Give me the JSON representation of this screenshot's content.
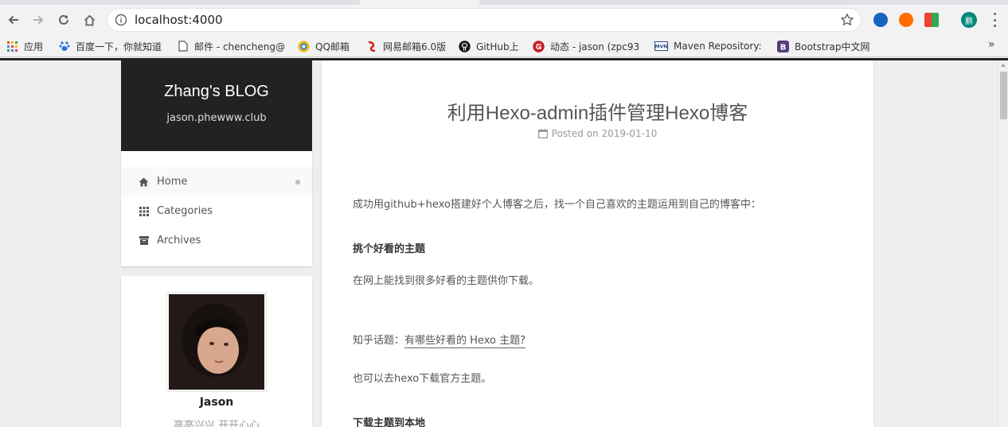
{
  "browser": {
    "url": "localhost:4000",
    "profile_initial": "鹏",
    "bookmarks": [
      {
        "label": "应用",
        "icon": "apps-grid-icon"
      },
      {
        "label": "百度一下，你就知道",
        "icon": "baidu-paw-icon"
      },
      {
        "label": "邮件 - chencheng@",
        "icon": "document-icon"
      },
      {
        "label": "QQ邮箱",
        "icon": "qq-mail-icon"
      },
      {
        "label": "网易邮箱6.0版",
        "icon": "netease-mail-icon"
      },
      {
        "label": "GitHub上",
        "icon": "github-icon"
      },
      {
        "label": "动态 - jason (zpc93",
        "icon": "gitee-icon"
      },
      {
        "label": "Maven Repository:",
        "icon": "maven-icon"
      },
      {
        "label": "Bootstrap中文网",
        "icon": "bootstrap-icon"
      }
    ],
    "bookmarks_overflow": "»"
  },
  "sidebar": {
    "brand_title": "Zhang's BLOG",
    "brand_subtitle": "jason.phewww.club",
    "menu": [
      {
        "label": "Home",
        "icon": "home-icon",
        "active": true
      },
      {
        "label": "Categories",
        "icon": "th-grid-icon",
        "active": false
      },
      {
        "label": "Archives",
        "icon": "archive-box-icon",
        "active": false
      }
    ],
    "author_name": "Jason",
    "author_motto": "高高兴兴 开开心心"
  },
  "post": {
    "title": "利用Hexo-admin插件管理Hexo博客",
    "meta_prefix": "Posted on",
    "date": "2019-01-10",
    "paragraphs": {
      "intro": "成功用github+hexo搭建好个人博客之后，找一个自己喜欢的主题运用到自己的博客中：",
      "heading_theme": "挑个好看的主题",
      "find_themes": "在网上能找到很多好看的主题供你下载。",
      "zhihu_prefix": "知乎话题：",
      "zhihu_link": "有哪些好看的 Hexo 主题?",
      "official": "也可以去hexo下载官方主题。",
      "heading_download": "下载主题到本地"
    }
  },
  "colors": {
    "brand_bg": "#222222",
    "page_bg": "#eeeeee",
    "text": "#555555",
    "muted": "#999999"
  }
}
